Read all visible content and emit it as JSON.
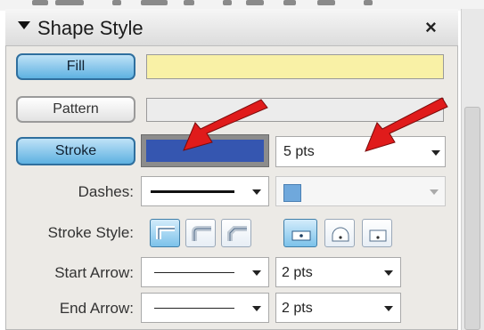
{
  "panel": {
    "title": "Shape Style",
    "close_label": "×"
  },
  "buttons": {
    "fill": "Fill",
    "pattern": "Pattern",
    "stroke": "Stroke"
  },
  "labels": {
    "dashes": "Dashes:",
    "stroke_style": "Stroke Style:",
    "start_arrow": "Start Arrow:",
    "end_arrow": "End Arrow:"
  },
  "values": {
    "stroke_width": "5 pts",
    "start_arrow_size": "2 pts",
    "end_arrow_size": "2 pts"
  },
  "colors": {
    "fill": "#f9f1a6",
    "stroke": "#3556b0",
    "dash_color": "#6fa8dc",
    "arrow_annotation": "#e01b1b"
  },
  "icons": {
    "title_toggle": "collapse-triangle-icon",
    "stroke_style_options": [
      "cap-flat-icon",
      "cap-round-icon",
      "cap-square-icon"
    ],
    "join_options": [
      "join-miter-icon",
      "join-round-icon",
      "join-bevel-icon"
    ]
  }
}
